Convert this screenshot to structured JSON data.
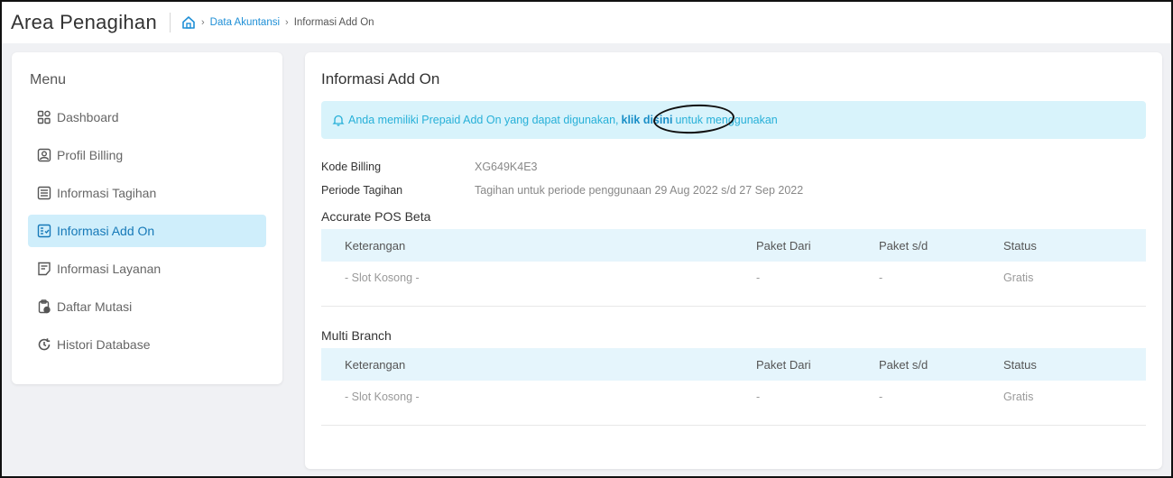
{
  "header": {
    "title": "Area Penagihan",
    "breadcrumb": [
      "Data Akuntansi",
      "Informasi Add On"
    ]
  },
  "sidebar": {
    "menu_label": "Menu",
    "items": [
      {
        "label": "Dashboard",
        "icon": "dashboard-icon"
      },
      {
        "label": "Profil Billing",
        "icon": "profile-icon"
      },
      {
        "label": "Informasi Tagihan",
        "icon": "document-icon"
      },
      {
        "label": "Informasi Add On",
        "icon": "addon-icon",
        "active": true
      },
      {
        "label": "Informasi Layanan",
        "icon": "service-icon"
      },
      {
        "label": "Daftar Mutasi",
        "icon": "clipboard-icon"
      },
      {
        "label": "Histori Database",
        "icon": "history-icon"
      }
    ]
  },
  "main": {
    "title": "Informasi Add On",
    "alert": {
      "text_before": "Anda memiliki Prepaid Add On yang dapat digunakan,",
      "link": "klik disini",
      "text_after": "untuk menggunakan"
    },
    "info": [
      {
        "key": "Kode Billing",
        "value": "XG649K4E3"
      },
      {
        "key": "Periode Tagihan",
        "value": "Tagihan untuk periode penggunaan 29 Aug 2022 s/d 27 Sep 2022"
      }
    ],
    "columns": [
      "Keterangan",
      "Paket Dari",
      "Paket s/d",
      "Status"
    ],
    "sections": [
      {
        "title": "Accurate POS Beta",
        "rows": [
          [
            "- Slot Kosong -",
            "-",
            "-",
            "Gratis"
          ]
        ]
      },
      {
        "title": "Multi Branch",
        "rows": [
          [
            "- Slot Kosong -",
            "-",
            "-",
            "Gratis"
          ]
        ]
      }
    ]
  },
  "colors": {
    "accent": "#1f8fd6",
    "active_bg": "#cfeefb",
    "alert_bg": "#d8f3fb",
    "table_header_bg": "#e5f5fc"
  }
}
